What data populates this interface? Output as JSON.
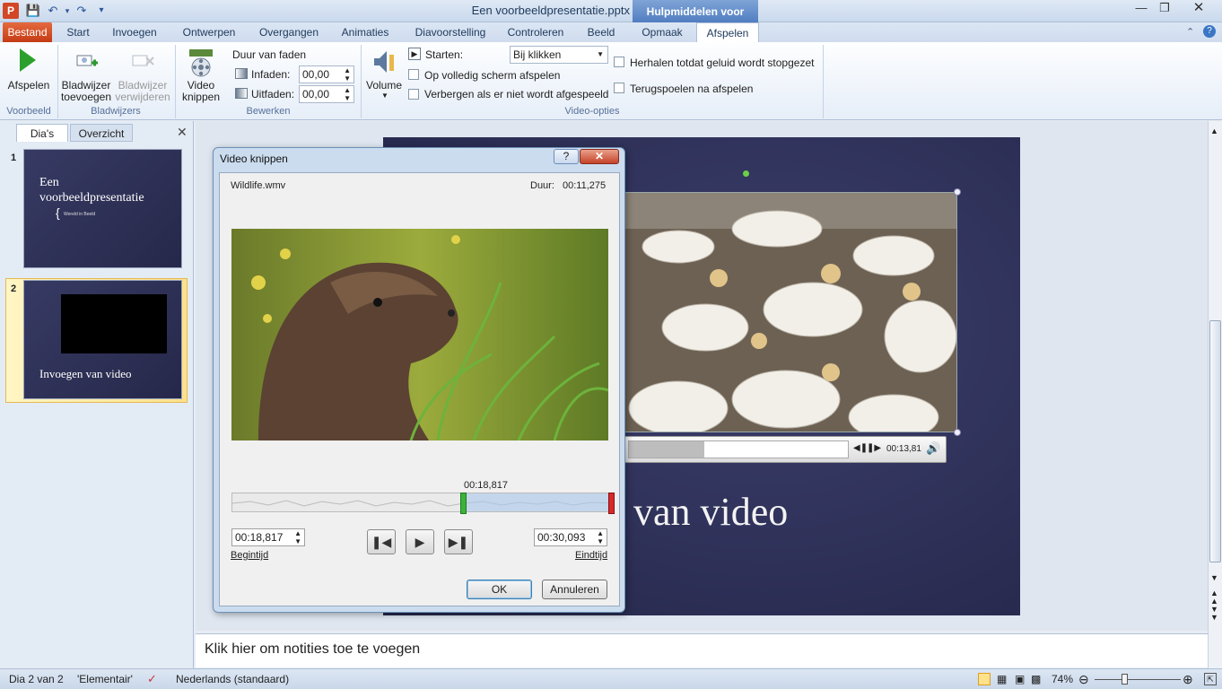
{
  "window": {
    "title": "Een voorbeeldpresentatie.pptx - Microsoft PowerPoint",
    "context_tab_group": "Hulpmiddelen voor video"
  },
  "tabs": [
    "Bestand",
    "Start",
    "Invoegen",
    "Ontwerpen",
    "Overgangen",
    "Animaties",
    "Diavoorstelling",
    "Controleren",
    "Beeld",
    "Opmaak",
    "Afspelen"
  ],
  "ribbon": {
    "preview": {
      "play": "Afspelen",
      "group": "Voorbeeld"
    },
    "bookmarks": {
      "add_1": "Bladwijzer",
      "add_2": "toevoegen",
      "remove_1": "Bladwijzer",
      "remove_2": "verwijderen",
      "group": "Bladwijzers"
    },
    "edit": {
      "trim_1": "Video",
      "trim_2": "knippen",
      "fade_title": "Duur van faden",
      "fade_in_label": "Infaden:",
      "fade_in_value": "00,00",
      "fade_out_label": "Uitfaden:",
      "fade_out_value": "00,00",
      "group": "Bewerken"
    },
    "video_options": {
      "volume": "Volume",
      "start_label": "Starten:",
      "start_value": "Bij klikken",
      "fullscreen": "Op volledig scherm afspelen",
      "hide": "Verbergen als er niet wordt afgespeeld",
      "loop": "Herhalen totdat geluid wordt stopgezet",
      "rewind": "Terugspoelen na afspelen",
      "group": "Video-opties"
    }
  },
  "left_pane": {
    "tab_slides": "Dia's",
    "tab_outline": "Overzicht",
    "slides": [
      {
        "num": "1",
        "title_1": "Een",
        "title_2": "voorbeeldpresentatie",
        "subtitle": "Wereld in Beeld"
      },
      {
        "num": "2",
        "title": "Invoegen van video"
      }
    ]
  },
  "slide": {
    "title_visible": "van video",
    "player_time": "00:13,81"
  },
  "notes": {
    "placeholder": "Klik hier om notities toe te voegen"
  },
  "status": {
    "slide": "Dia 2 van 2",
    "theme": "'Elementair'",
    "language": "Nederlands (standaard)",
    "zoom": "74%"
  },
  "dialog": {
    "title": "Video knippen",
    "help": "?",
    "filename": "Wildlife.wmv",
    "duration_label": "Duur:",
    "duration_value": "00:11,275",
    "marker_time": "00:18,817",
    "start_value": "00:18,817",
    "start_label": "Begintijd",
    "end_value": "00:30,093",
    "end_label": "Eindtijd",
    "ok": "OK",
    "cancel": "Annuleren"
  }
}
